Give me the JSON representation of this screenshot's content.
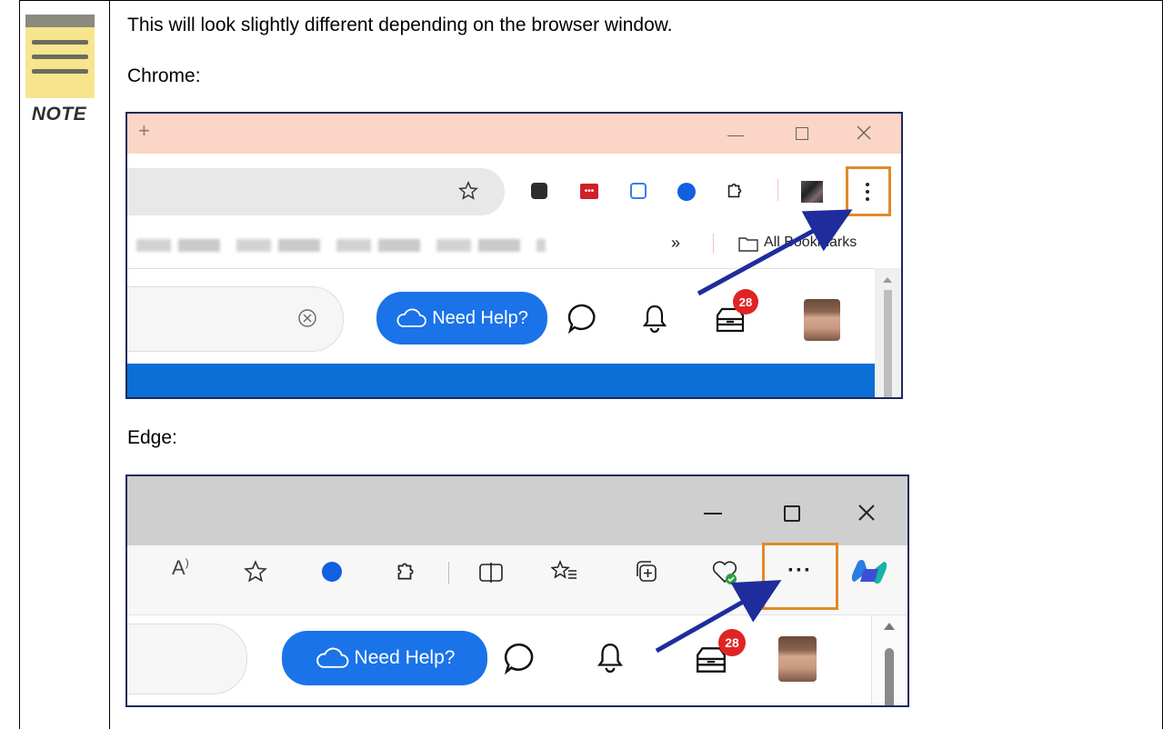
{
  "note": {
    "label": "NOTE"
  },
  "text": {
    "intro": "This will look slightly different depending on the browser window.",
    "chrome_label": "Chrome:",
    "edge_label": "Edge:"
  },
  "chrome": {
    "new_tab": "+",
    "overflow": "»",
    "all_bookmarks": "All Bookmarks",
    "need_help": "Need Help?",
    "badge_count": "28"
  },
  "edge": {
    "read_aloud": "A",
    "menu_dots": "···",
    "need_help": "Need Help?",
    "badge_count": "28"
  },
  "colors": {
    "arrow": "#1f2c9c",
    "highlight": "#e08a2b",
    "brand_blue": "#1a73e8",
    "chrome_tabstrip": "#fbd5c5",
    "edge_titlebar": "#cfcfcf"
  }
}
